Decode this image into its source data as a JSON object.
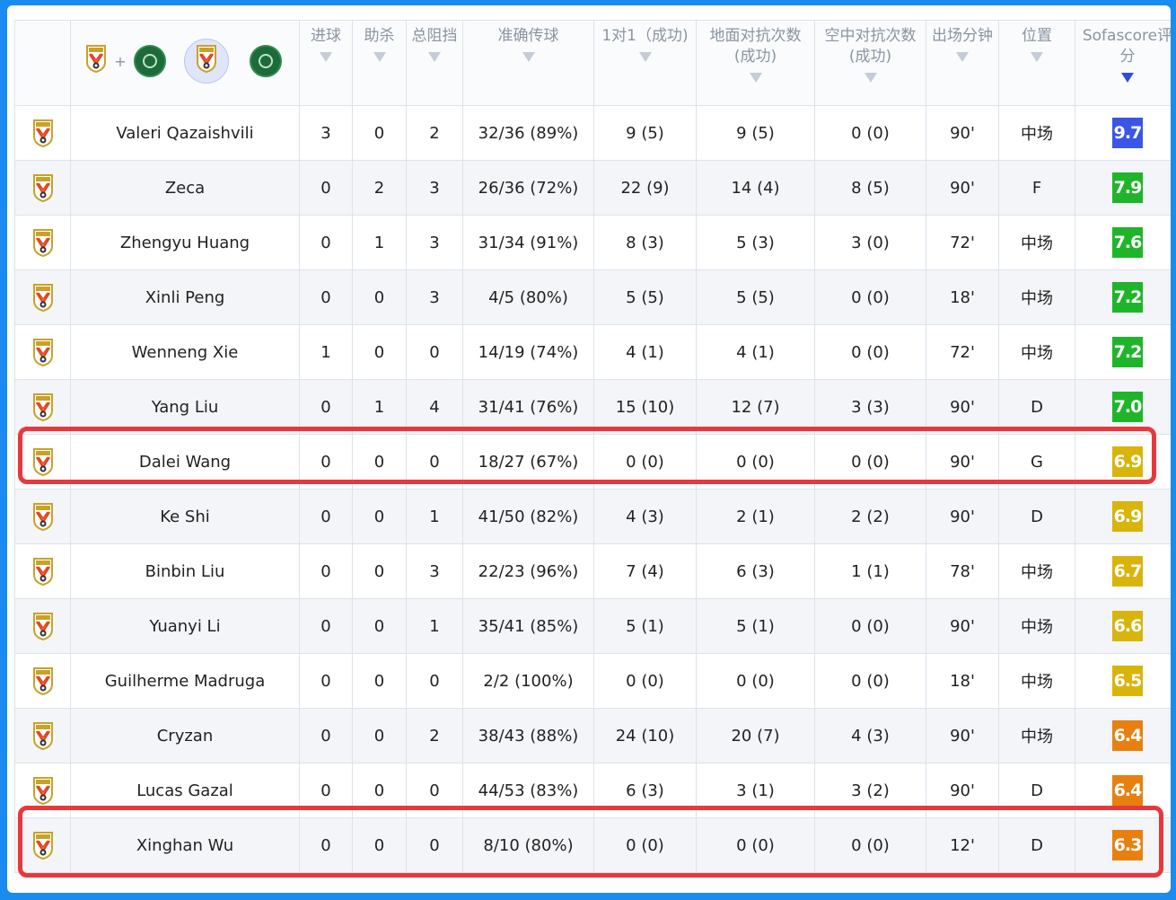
{
  "table": {
    "headers": [
      {
        "label": "",
        "name": "crest-col"
      },
      {
        "label": "",
        "name": "player-col"
      },
      {
        "label": "进球",
        "name": "goals"
      },
      {
        "label": "助杀",
        "name": "assists"
      },
      {
        "label": "总阻挡",
        "name": "blocks"
      },
      {
        "label": "准确传球",
        "name": "accurate-passes"
      },
      {
        "label": "1对1（成功)",
        "name": "duels"
      },
      {
        "label": "地面对抗次数(成功)",
        "name": "ground-duels"
      },
      {
        "label": "空中对抗次数(成功)",
        "name": "aerial-duels"
      },
      {
        "label": "出场分钟",
        "name": "minutes"
      },
      {
        "label": "位置",
        "name": "position"
      },
      {
        "label": "Sofascore评分",
        "name": "rating"
      }
    ],
    "sorted_column": "rating",
    "team_filter": {
      "plus_label": "+"
    },
    "rows": [
      {
        "player": "Valeri Qazaishvili",
        "goals": "3",
        "assists": "0",
        "blocks": "2",
        "passes": "32/36 (89%)",
        "duels": "9 (5)",
        "ground": "9 (5)",
        "aerial": "0 (0)",
        "minutes": "90'",
        "position": "中场",
        "rating": "9.7",
        "rating_color": "#3a56e6"
      },
      {
        "player": "Zeca",
        "goals": "0",
        "assists": "2",
        "blocks": "3",
        "passes": "26/36 (72%)",
        "duels": "22 (9)",
        "ground": "14 (4)",
        "aerial": "8 (5)",
        "minutes": "90'",
        "position": "F",
        "rating": "7.9",
        "rating_color": "#1fb52a"
      },
      {
        "player": "Zhengyu Huang",
        "goals": "0",
        "assists": "1",
        "blocks": "3",
        "passes": "31/34 (91%)",
        "duels": "8 (3)",
        "ground": "5 (3)",
        "aerial": "3 (0)",
        "minutes": "72'",
        "position": "中场",
        "rating": "7.6",
        "rating_color": "#1fb52a"
      },
      {
        "player": "Xinli Peng",
        "goals": "0",
        "assists": "0",
        "blocks": "3",
        "passes": "4/5 (80%)",
        "duels": "5 (5)",
        "ground": "5 (5)",
        "aerial": "0 (0)",
        "minutes": "18'",
        "position": "中场",
        "rating": "7.2",
        "rating_color": "#1fb52a"
      },
      {
        "player": "Wenneng Xie",
        "goals": "1",
        "assists": "0",
        "blocks": "0",
        "passes": "14/19 (74%)",
        "duels": "4 (1)",
        "ground": "4 (1)",
        "aerial": "0 (0)",
        "minutes": "72'",
        "position": "中场",
        "rating": "7.2",
        "rating_color": "#1fb52a"
      },
      {
        "player": "Yang Liu",
        "goals": "0",
        "assists": "1",
        "blocks": "4",
        "passes": "31/41 (76%)",
        "duels": "15 (10)",
        "ground": "12 (7)",
        "aerial": "3 (3)",
        "minutes": "90'",
        "position": "D",
        "rating": "7.0",
        "rating_color": "#1fb52a"
      },
      {
        "player": "Dalei Wang",
        "goals": "0",
        "assists": "0",
        "blocks": "0",
        "passes": "18/27 (67%)",
        "duels": "0 (0)",
        "ground": "0 (0)",
        "aerial": "0 (0)",
        "minutes": "90'",
        "position": "G",
        "rating": "6.9",
        "rating_color": "#d9b40a",
        "highlighted": true
      },
      {
        "player": "Ke Shi",
        "goals": "0",
        "assists": "0",
        "blocks": "1",
        "passes": "41/50 (82%)",
        "duels": "4 (3)",
        "ground": "2 (1)",
        "aerial": "2 (2)",
        "minutes": "90'",
        "position": "D",
        "rating": "6.9",
        "rating_color": "#d9b40a"
      },
      {
        "player": "Binbin Liu",
        "goals": "0",
        "assists": "0",
        "blocks": "3",
        "passes": "22/23 (96%)",
        "duels": "7 (4)",
        "ground": "6 (3)",
        "aerial": "1 (1)",
        "minutes": "78'",
        "position": "中场",
        "rating": "6.7",
        "rating_color": "#d9b40a"
      },
      {
        "player": "Yuanyi Li",
        "goals": "0",
        "assists": "0",
        "blocks": "1",
        "passes": "35/41 (85%)",
        "duels": "5 (1)",
        "ground": "5 (1)",
        "aerial": "0 (0)",
        "minutes": "90'",
        "position": "中场",
        "rating": "6.6",
        "rating_color": "#d9b40a"
      },
      {
        "player": "Guilherme Madruga",
        "goals": "0",
        "assists": "0",
        "blocks": "0",
        "passes": "2/2 (100%)",
        "duels": "0 (0)",
        "ground": "0 (0)",
        "aerial": "0 (0)",
        "minutes": "18'",
        "position": "中场",
        "rating": "6.5",
        "rating_color": "#d9b40a"
      },
      {
        "player": "Cryzan",
        "goals": "0",
        "assists": "0",
        "blocks": "2",
        "passes": "38/43 (88%)",
        "duels": "24 (10)",
        "ground": "20 (7)",
        "aerial": "4 (3)",
        "minutes": "90'",
        "position": "中场",
        "rating": "6.4",
        "rating_color": "#e8800f"
      },
      {
        "player": "Lucas Gazal",
        "goals": "0",
        "assists": "0",
        "blocks": "0",
        "passes": "44/53 (83%)",
        "duels": "6 (3)",
        "ground": "3 (1)",
        "aerial": "3 (2)",
        "minutes": "90'",
        "position": "D",
        "rating": "6.4",
        "rating_color": "#e8800f"
      },
      {
        "player": "Xinghan Wu",
        "goals": "0",
        "assists": "0",
        "blocks": "0",
        "passes": "8/10 (80%)",
        "duels": "0 (0)",
        "ground": "0 (0)",
        "aerial": "0 (0)",
        "minutes": "12'",
        "position": "D",
        "rating": "6.3",
        "rating_color": "#e8800f",
        "highlighted": true
      }
    ]
  },
  "colors": {
    "page_background": "#1a8cf0",
    "header_text": "#8a94a3",
    "sort_active": "#2b4fd8",
    "highlight_border": "#e8383d"
  },
  "icons": {
    "team_crest": "shandong-crest-icon",
    "opponent_crest": "opponent-crest-icon"
  }
}
